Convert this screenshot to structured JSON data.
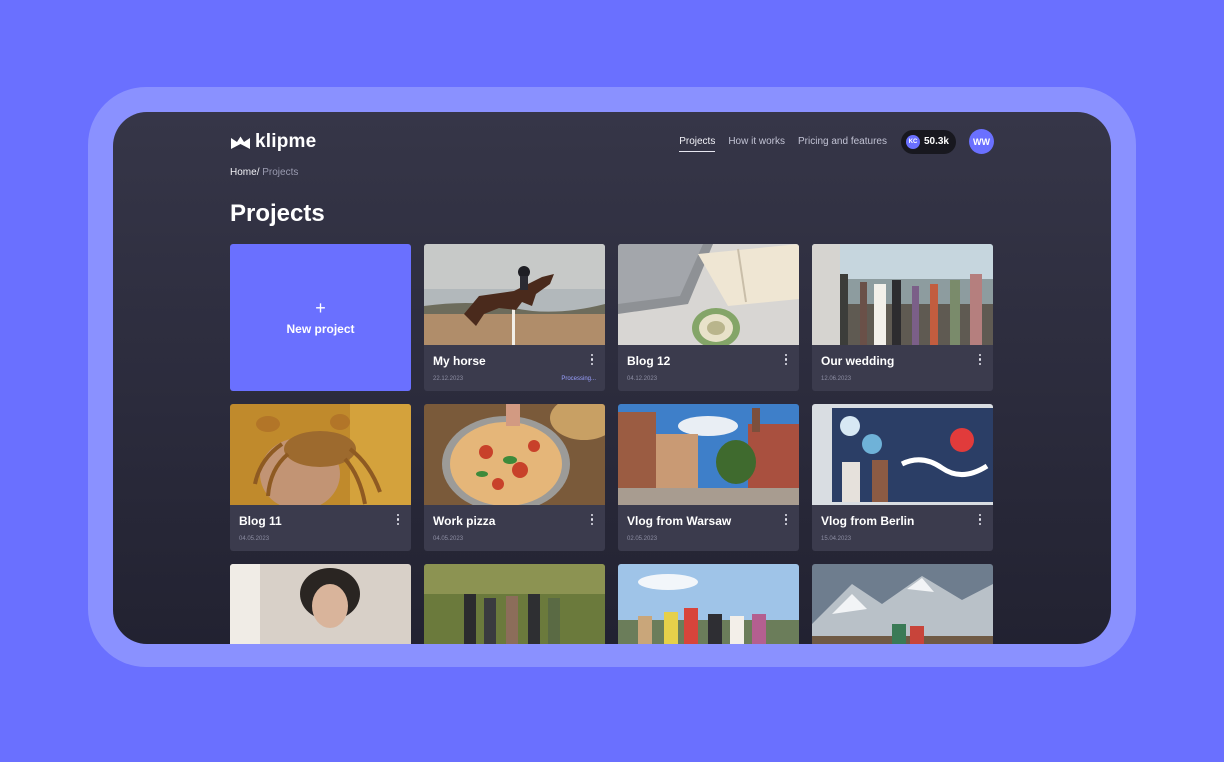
{
  "brand": {
    "name": "klipme"
  },
  "nav": {
    "links": [
      "Projects",
      "How it works",
      "Pricing and features"
    ],
    "active": "Projects",
    "credits_badge": "KC",
    "credits_value": "50.3k",
    "avatar_initials": "WW"
  },
  "breadcrumb": {
    "home": "Home",
    "separator": "/",
    "current": "Projects"
  },
  "page": {
    "title": "Projects"
  },
  "new_project": {
    "icon": "+",
    "label": "New project"
  },
  "projects": [
    {
      "title": "My horse",
      "date": "22.12.2023",
      "status": "Processing..."
    },
    {
      "title": "Blog 12",
      "date": "04.12.2023",
      "status": ""
    },
    {
      "title": "Our wedding",
      "date": "12.06.2023",
      "status": ""
    },
    {
      "title": "Blog 11",
      "date": "04.05.2023",
      "status": ""
    },
    {
      "title": "Work pizza",
      "date": "04.05.2023",
      "status": ""
    },
    {
      "title": "Vlog from Warsaw",
      "date": "02.05.2023",
      "status": ""
    },
    {
      "title": "Vlog from Berlin",
      "date": "15.04.2023",
      "status": ""
    }
  ],
  "colors": {
    "background": "#6a70ff",
    "frame": "#8a91ff",
    "accent": "#6a70ff",
    "card": "#3b3b4d"
  },
  "icons": [
    "logo-icon",
    "plus-icon",
    "more-vertical-icon"
  ]
}
